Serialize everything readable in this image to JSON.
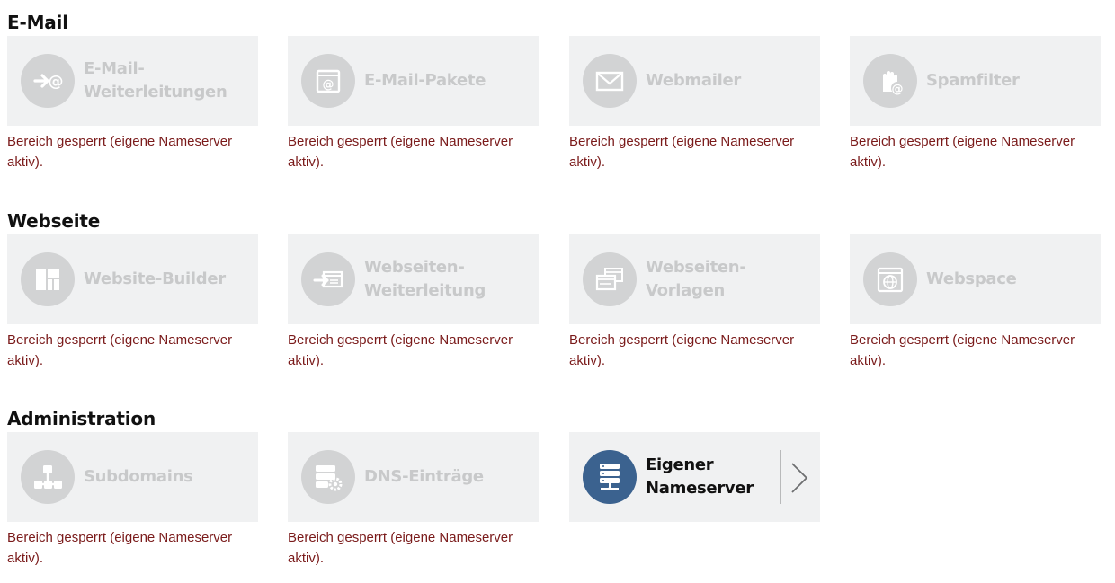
{
  "sections": [
    {
      "title": "E-Mail",
      "tiles": [
        {
          "label": "E-Mail-Weiterleitungen",
          "note": "Bereich gesperrt (eigene Nameserver aktiv).",
          "icon": "mail-forward-icon"
        },
        {
          "label": "E-Mail-Pakete",
          "note": "Bereich gesperrt (eigene Nameserver aktiv).",
          "icon": "mail-package-icon"
        },
        {
          "label": "Webmailer",
          "note": "Bereich gesperrt (eigene Nameserver aktiv).",
          "icon": "envelope-icon"
        },
        {
          "label": "Spamfilter",
          "note": "Bereich gesperrt (eigene Nameserver aktiv).",
          "icon": "spamfilter-hand-icon"
        }
      ]
    },
    {
      "title": "Webseite",
      "tiles": [
        {
          "label": "Website-Builder",
          "note": "Bereich gesperrt (eigene Nameserver aktiv).",
          "icon": "layout-grid-icon"
        },
        {
          "label": "Webseiten-Weiterleitung",
          "note": "Bereich gesperrt (eigene Nameserver aktiv).",
          "icon": "web-forward-icon"
        },
        {
          "label": "Webseiten-Vorlagen",
          "note": "Bereich gesperrt (eigene Nameserver aktiv).",
          "icon": "template-windows-icon"
        },
        {
          "label": "Webspace",
          "note": "Bereich gesperrt (eigene Nameserver aktiv).",
          "icon": "globe-box-icon"
        }
      ]
    },
    {
      "title": "Administration",
      "tiles": [
        {
          "label": "Subdomains",
          "note": "Bereich gesperrt (eigene Nameserver aktiv).",
          "icon": "sitemap-icon"
        },
        {
          "label": "DNS-Einträge",
          "note": "Bereich gesperrt (eigene Nameserver aktiv).",
          "icon": "server-gear-icon"
        },
        {
          "label": "Eigener Nameserver",
          "icon": "nameserver-icon",
          "active": true
        }
      ]
    }
  ],
  "colors": {
    "tile_bg": "#f0f1f2",
    "icon_disabled": "#d2d3d4",
    "label_disabled": "#c8c9ca",
    "icon_active": "#3b628f",
    "note_text": "#7a1a1a"
  }
}
